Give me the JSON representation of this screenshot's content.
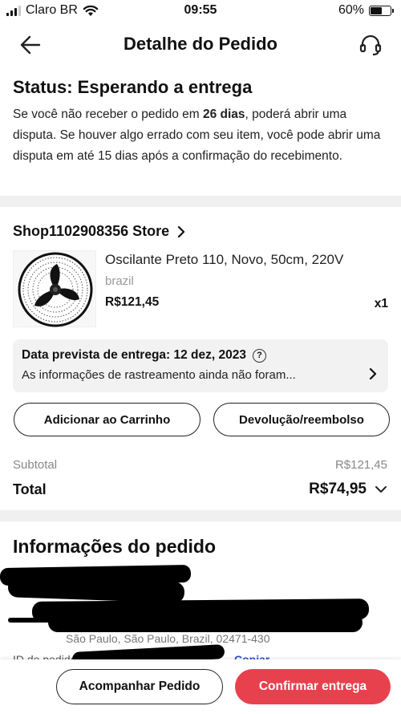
{
  "status_bar": {
    "carrier": "Claro BR",
    "time": "09:55",
    "battery": "60%",
    "battery_level": 0.6
  },
  "header": {
    "title": "Detalhe do Pedido",
    "back_icon": "arrow-left-icon",
    "support_icon": "headset-icon"
  },
  "status": {
    "title": "Status: Esperando a entrega",
    "text_before": "Se você não receber o pedido em ",
    "days": "26 dias",
    "text_after": ", poderá abrir uma disputa. Se houver algo errado com seu item, você pode abrir uma disputa em até 15 dias após a confirmação do recebimento."
  },
  "shop": {
    "name": "Shop1102908356 Store"
  },
  "product": {
    "name": "Oscilante Preto 110, Novo, 50cm, 220V",
    "origin": "brazil",
    "price": "R$121,45",
    "quantity": "x1"
  },
  "delivery": {
    "title": "Data prevista de entrega: 12 dez, 2023",
    "help_symbol": "?",
    "tracking": "As informações de rastreamento ainda não foram..."
  },
  "actions": {
    "add_to_cart": "Adicionar ao Carrinho",
    "refund": "Devolução/reembolso"
  },
  "summary": {
    "subtotal_label": "Subtotal",
    "subtotal_value": "R$121,45",
    "total_label": "Total",
    "total_value": "R$74,95"
  },
  "order_info": {
    "title": "Informações do pedido",
    "address_partial": "São Paulo, São Paulo, Brazil, 02471-430",
    "id_label": "ID do pedido",
    "copy_label": "Copiar"
  },
  "bottom": {
    "track_label": "Acompanhar Pedido",
    "confirm_label": "Confirmar entrega"
  },
  "colors": {
    "primary": "#e8414e",
    "link": "#2b4fd6",
    "muted": "#888888",
    "divider": "#f0f0f0"
  }
}
